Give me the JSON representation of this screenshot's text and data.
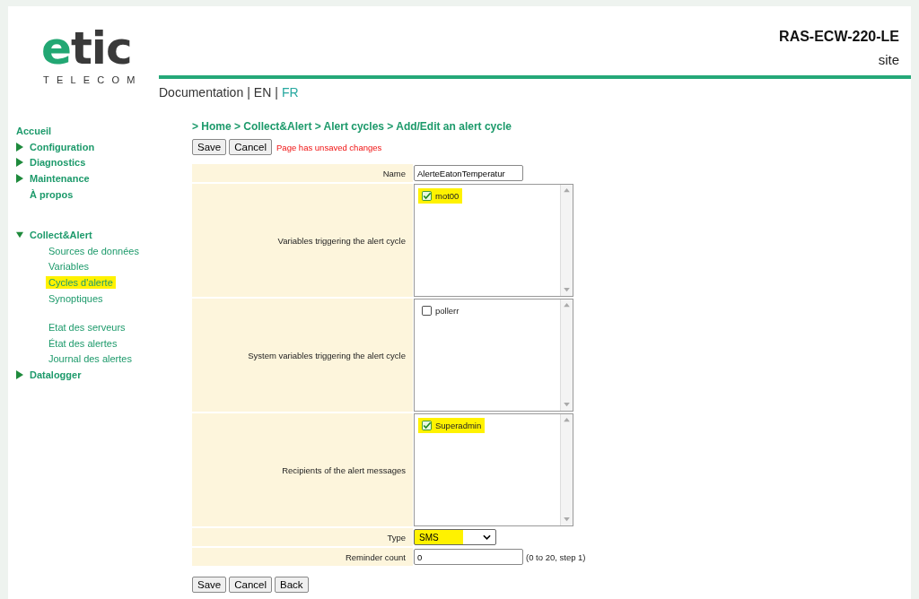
{
  "logo": {
    "word_accent": "e",
    "word_rest": "tic",
    "tagline": "TELECOM"
  },
  "header": {
    "device": "RAS-ECW-220-LE",
    "site": "site"
  },
  "top_links": [
    {
      "label": "Documentation",
      "selected": false
    },
    {
      "label": "EN",
      "selected": false
    },
    {
      "label": "FR",
      "selected": true
    }
  ],
  "top_link_separator": "|",
  "sidebar": {
    "sections": [
      {
        "items": [
          {
            "label": "Accueil",
            "kind": "plain"
          },
          {
            "label": "Configuration",
            "kind": "collapsed"
          },
          {
            "label": "Diagnostics",
            "kind": "collapsed"
          },
          {
            "label": "Maintenance",
            "kind": "collapsed"
          },
          {
            "label": "À propos",
            "kind": "plain"
          }
        ]
      },
      {
        "items": [
          {
            "label": "Collect&Alert",
            "kind": "expanded",
            "child_groups": [
              {
                "children": [
                  {
                    "label": "Sources de données",
                    "highlighted": false
                  },
                  {
                    "label": "Variables",
                    "highlighted": false
                  },
                  {
                    "label": "Cycles d'alerte",
                    "highlighted": true
                  },
                  {
                    "label": "Synoptiques",
                    "highlighted": false
                  }
                ]
              },
              {
                "children": [
                  {
                    "label": "Etat des serveurs",
                    "highlighted": false
                  },
                  {
                    "label": "État des alertes",
                    "highlighted": false
                  },
                  {
                    "label": "Journal des alertes",
                    "highlighted": false
                  }
                ]
              }
            ]
          },
          {
            "label": "Datalogger",
            "kind": "collapsed"
          }
        ]
      }
    ]
  },
  "breadcrumb": "> Home > Collect&Alert > Alert cycles > Add/Edit an alert cycle",
  "top_buttons": [
    "Save",
    "Cancel"
  ],
  "warning": "Page has unsaved changes",
  "form": [
    {
      "kind": "text",
      "label": "Name",
      "value": "AlerteEatonTemperatur"
    },
    {
      "kind": "list",
      "label": "Variables triggering the alert cycle",
      "items": [
        {
          "label": "mot00",
          "checked": true,
          "highlighted": true
        }
      ]
    },
    {
      "kind": "list",
      "label": "System variables triggering the alert cycle",
      "items": [
        {
          "label": "pollerr",
          "checked": false,
          "highlighted": false
        }
      ]
    },
    {
      "kind": "list",
      "label": "Recipients of the alert messages",
      "items": [
        {
          "label": "Superadmin",
          "checked": true,
          "highlighted": true
        }
      ]
    },
    {
      "kind": "select",
      "label": "Type",
      "value": "SMS",
      "highlighted": true
    },
    {
      "kind": "text",
      "label": "Reminder count",
      "value": "0",
      "hint": "(0 to 20, step 1)"
    }
  ],
  "bottom_buttons": [
    "Save",
    "Cancel",
    "Back"
  ]
}
